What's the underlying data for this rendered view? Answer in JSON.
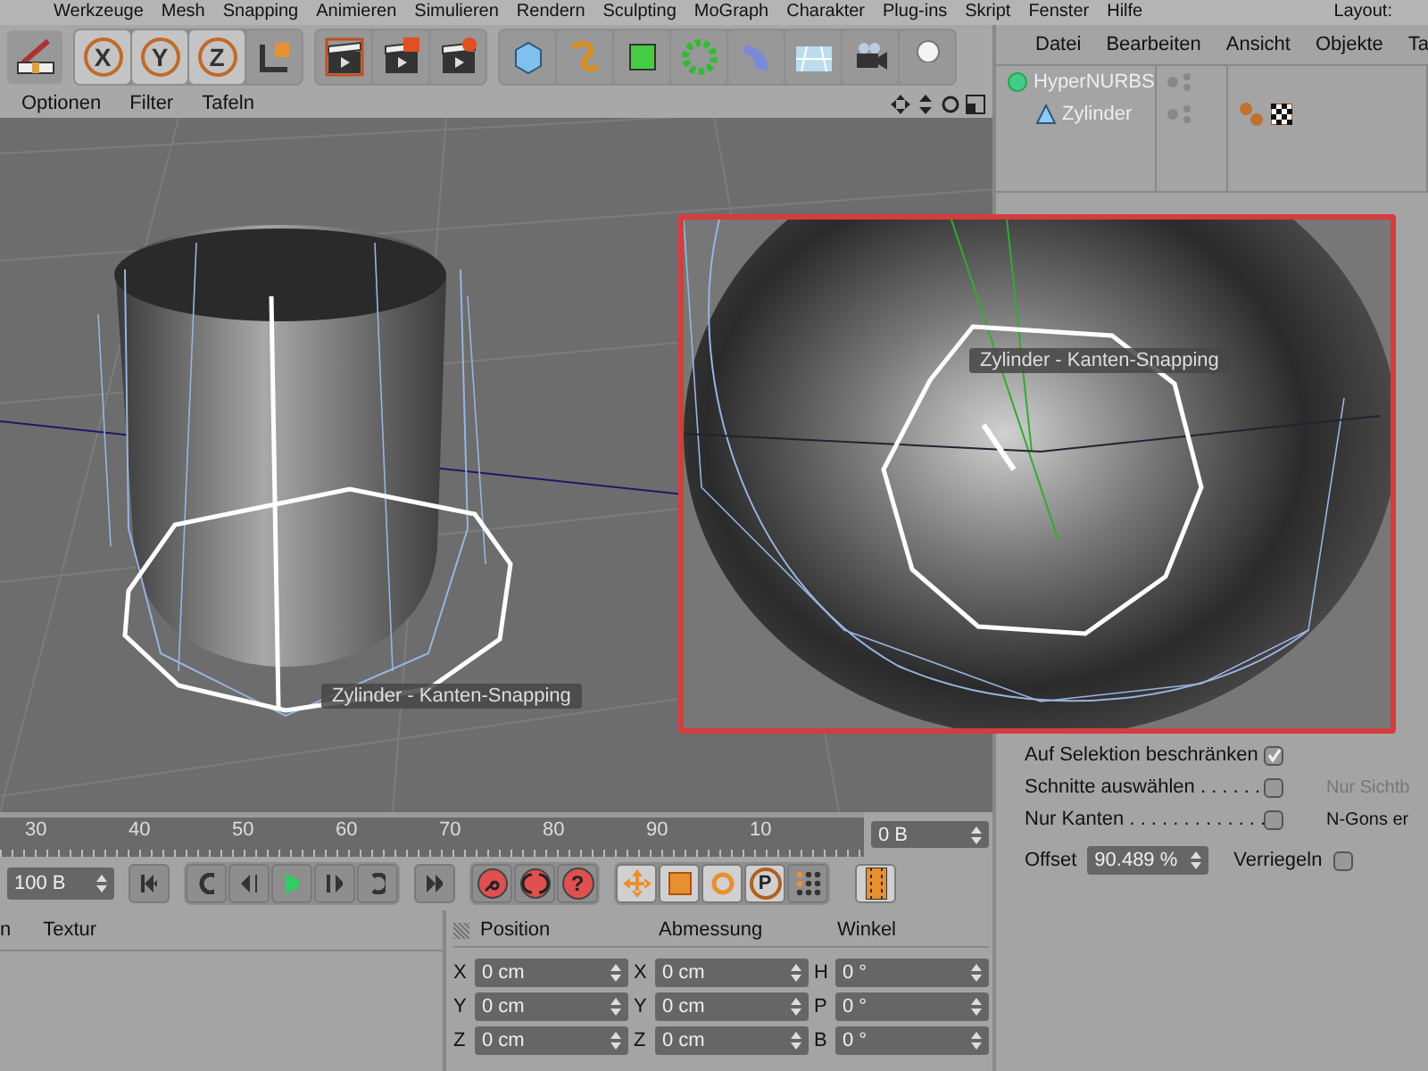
{
  "menu_bar": {
    "items": [
      "Werkzeuge",
      "Mesh",
      "Snapping",
      "Animieren",
      "Simulieren",
      "Rendern",
      "Sculpting",
      "MoGraph",
      "Charakter",
      "Plug-ins",
      "Skript",
      "Fenster",
      "Hilfe"
    ],
    "layout_label": "Layout:"
  },
  "toolbar": {
    "axis_buttons": [
      "X",
      "Y",
      "Z"
    ]
  },
  "viewport": {
    "menu": [
      "Optionen",
      "Filter",
      "Tafeln"
    ],
    "tooltip": "Zylinder - Kanten-Snapping"
  },
  "inset": {
    "tooltip": "Zylinder - Kanten-Snapping"
  },
  "object_manager": {
    "menu": [
      "Datei",
      "Bearbeiten",
      "Ansicht",
      "Objekte",
      "Ta"
    ],
    "tree": [
      {
        "name": "HyperNURBS",
        "kind": "nurbs",
        "children": [
          {
            "name": "Zylinder",
            "kind": "primitive"
          }
        ]
      }
    ]
  },
  "attributes": {
    "options": [
      {
        "label": "Auf Selektion beschränken",
        "checked": true
      },
      {
        "label": "Schnitte auswählen . . . . . .",
        "checked": false,
        "side_label": "Nur Sichtb",
        "side_disabled": true
      },
      {
        "label": "Nur Kanten . . . . . . . . . . . . .",
        "checked": false,
        "side_label": "N-Gons er",
        "side_disabled": false
      }
    ],
    "offset_label": "Offset",
    "offset_value": "90.489 %",
    "lock_label": "Verriegeln",
    "lock_checked": false
  },
  "timeline": {
    "ticks": [
      "30",
      "40",
      "50",
      "60",
      "70",
      "80",
      "90",
      "10"
    ],
    "frame_field": "0 B"
  },
  "transport": {
    "end_field": "100 B",
    "help_label": "?",
    "point_label": "P"
  },
  "material_panel": {
    "columns": [
      "n",
      "Textur"
    ]
  },
  "coordinates": {
    "headers": [
      "Position",
      "Abmessung",
      "Winkel"
    ],
    "rows": [
      {
        "cells": [
          {
            "axis": "X",
            "value": "0 cm"
          },
          {
            "axis": "X",
            "value": "0 cm"
          },
          {
            "axis": "H",
            "value": "0 °"
          }
        ]
      },
      {
        "cells": [
          {
            "axis": "Y",
            "value": "0 cm"
          },
          {
            "axis": "Y",
            "value": "0 cm"
          },
          {
            "axis": "P",
            "value": "0 °"
          }
        ]
      },
      {
        "cells": [
          {
            "axis": "Z",
            "value": "0 cm"
          },
          {
            "axis": "Z",
            "value": "0 cm"
          },
          {
            "axis": "B",
            "value": "0 °"
          }
        ]
      }
    ]
  }
}
